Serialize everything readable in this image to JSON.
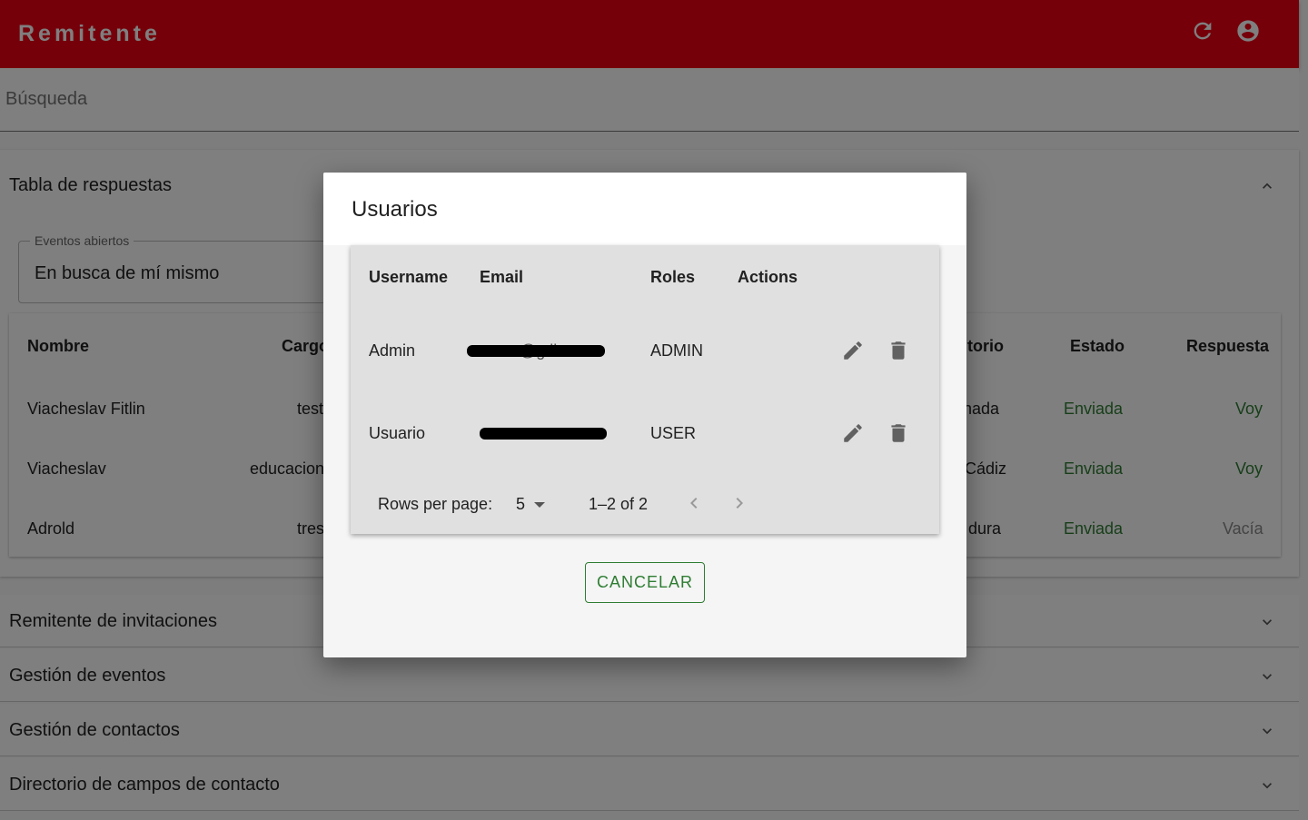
{
  "appbar": {
    "title": "Remitente",
    "icons": [
      "refresh-icon",
      "account-circle-icon"
    ],
    "color": "#eb0014"
  },
  "search": {
    "label": "Búsqueda"
  },
  "responses_panel": {
    "title": "Tabla de respuestas",
    "event_field": {
      "label": "Eventos abiertos",
      "value": "En busca de mí mismo"
    },
    "table": {
      "headers": {
        "nombre": "Nombre",
        "cargo": "Cargo",
        "territorio": "itorio",
        "estado": "Estado",
        "respuesta": "Respuesta"
      },
      "rows": [
        {
          "nombre": "Viacheslav Fitlin",
          "cargo": "test",
          "territorio": "nada",
          "estado": "Enviada",
          "respuesta": "Voy"
        },
        {
          "nombre": "Viacheslav",
          "cargo": "educacion",
          "territorio": "Cádiz",
          "estado": "Enviada",
          "respuesta": "Voy"
        },
        {
          "nombre": "Adrold",
          "cargo": "tres",
          "territorio": "dura",
          "estado": "Enviada",
          "respuesta": "Vacía"
        }
      ]
    }
  },
  "accordions": [
    {
      "label": "Remitente de invitaciones"
    },
    {
      "label": "Gestión de eventos"
    },
    {
      "label": "Gestión de contactos"
    },
    {
      "label": "Directorio de campos de contacto"
    }
  ],
  "dialog": {
    "title": "Usuarios",
    "headers": {
      "username": "Username",
      "email": "Email",
      "roles": "Roles",
      "actions": "Actions"
    },
    "rows": [
      {
        "username": "Admin",
        "email_visible": "@g         il.com",
        "roles": "ADMIN"
      },
      {
        "username": "Usuario",
        "email_visible": "",
        "roles": "USER"
      }
    ],
    "pagination": {
      "rows_label": "Rows per page:",
      "rows_value": "5",
      "range": "1–2 of 2"
    },
    "cancel_label": "CANCELAR",
    "accent_color": "#2e7d32"
  }
}
